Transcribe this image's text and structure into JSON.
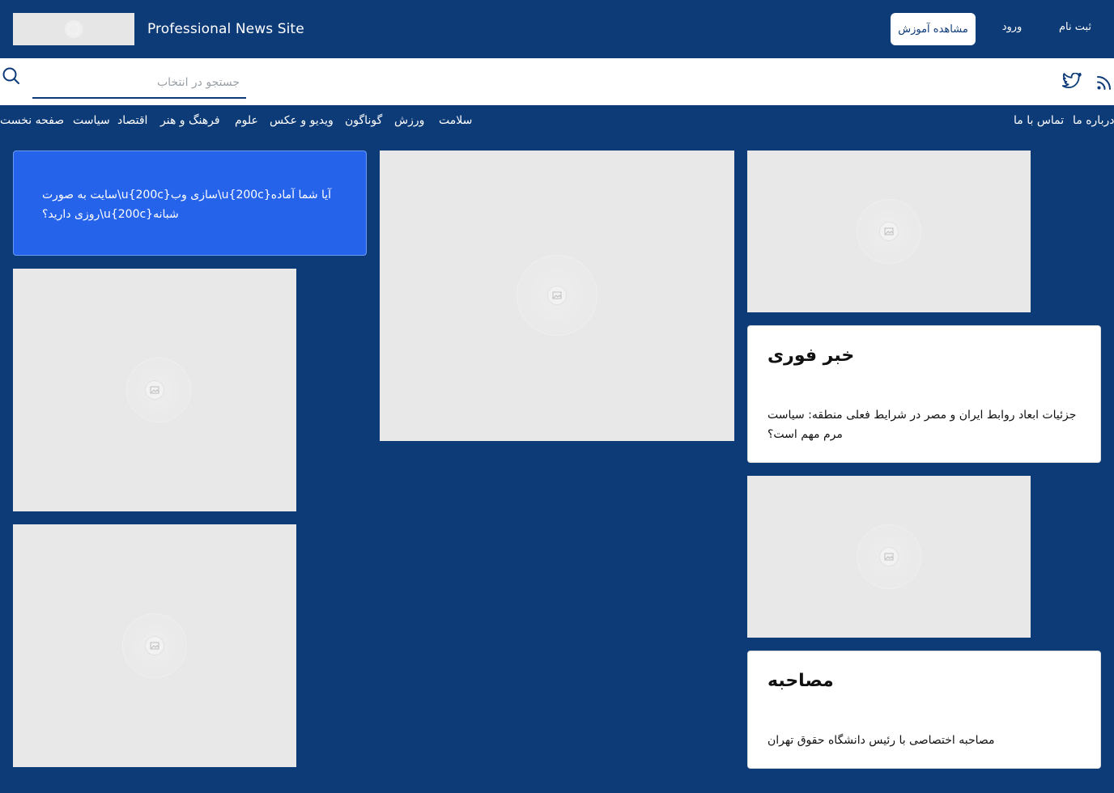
{
  "header": {
    "site_title": "Professional News Site",
    "tutorial_button": "مشاهده آموزش",
    "login_link": "ورود",
    "register_link": "ثبت نام"
  },
  "search": {
    "placeholder": "جستجو در انتخاب"
  },
  "nav": {
    "left_items": [
      "صفحه نخست",
      "سیاست",
      "اقتصاد",
      "فرهنگ و هنر",
      "علوم",
      "ویدیو و عکس",
      "گوناگون",
      "ورزش",
      "سلامت"
    ],
    "right_items": [
      "تماس با ما",
      "درباره ما"
    ]
  },
  "promo": {
    "text": "سایت به صورت\\u{200c}سازی وب\\u{200c}آیا شما آماده روزی دارید؟\\u{200c}شبانه"
  },
  "cards": {
    "breaking": {
      "title": "خبر فوری",
      "text": "جزئیات ابعاد روابط ایران و مصر در شرایط فعلی منطقه: سیاست مرم مهم است؟"
    },
    "interview": {
      "title": "مصاحبه",
      "text": "مصاحبه اختصاصی با رئیس دانشگاه حقوق تهران"
    }
  },
  "icons": {
    "search": "search-icon",
    "twitter": "twitter-icon",
    "rss": "rss-icon",
    "image_placeholder": "image-placeholder-icon"
  },
  "colors": {
    "background": "#0d3b78",
    "promo": "#2563eb",
    "placeholder": "#e8e8e8",
    "card": "#ffffff"
  }
}
